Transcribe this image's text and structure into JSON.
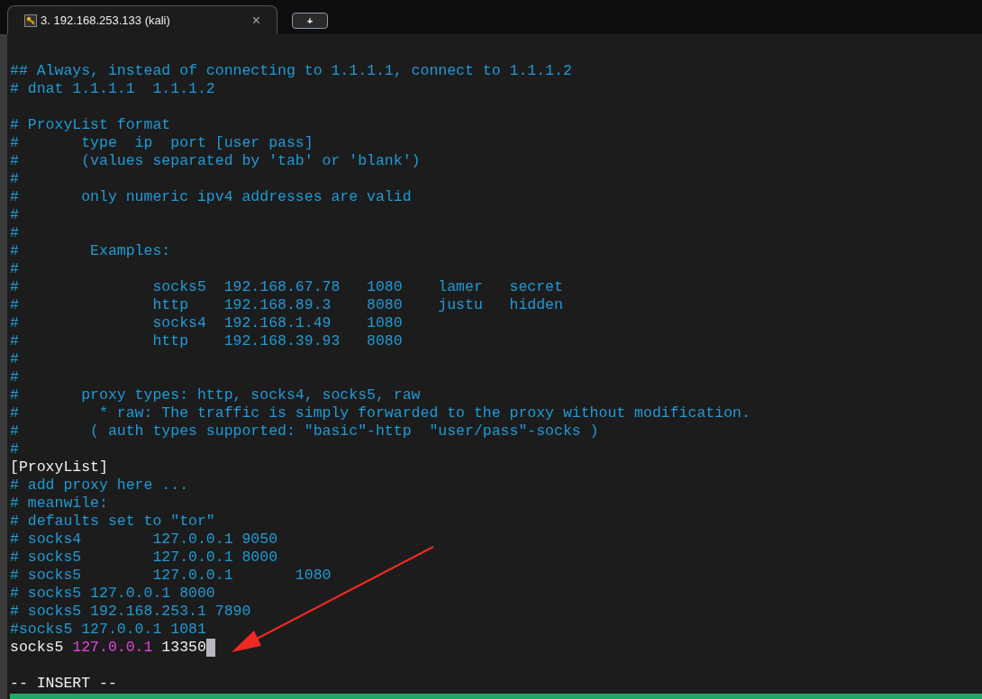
{
  "tab": {
    "title": "3. 192.168.253.133 (kali)",
    "close": "×",
    "new_tab": "+"
  },
  "lines": [
    {
      "kind": "text",
      "segments": [
        {
          "kind": "comment",
          "text": "## Always, instead of connecting to 1.1.1.1, connect to 1.1.1.2"
        }
      ]
    },
    {
      "kind": "text",
      "segments": [
        {
          "kind": "comment",
          "text": "# dnat 1.1.1.1  1.1.1.2"
        }
      ]
    },
    {
      "kind": "blank"
    },
    {
      "kind": "text",
      "segments": [
        {
          "kind": "comment",
          "text": "# ProxyList format"
        }
      ]
    },
    {
      "kind": "text",
      "segments": [
        {
          "kind": "comment",
          "text": "#       type  ip  port [user pass]"
        }
      ]
    },
    {
      "kind": "text",
      "segments": [
        {
          "kind": "comment",
          "text": "#       (values separated by 'tab' or 'blank')"
        }
      ]
    },
    {
      "kind": "text",
      "segments": [
        {
          "kind": "comment",
          "text": "#"
        }
      ]
    },
    {
      "kind": "text",
      "segments": [
        {
          "kind": "comment",
          "text": "#       only numeric ipv4 addresses are valid"
        }
      ]
    },
    {
      "kind": "text",
      "segments": [
        {
          "kind": "comment",
          "text": "#"
        }
      ]
    },
    {
      "kind": "text",
      "segments": [
        {
          "kind": "comment",
          "text": "#"
        }
      ]
    },
    {
      "kind": "text",
      "segments": [
        {
          "kind": "comment",
          "text": "#        Examples:"
        }
      ]
    },
    {
      "kind": "text",
      "segments": [
        {
          "kind": "comment",
          "text": "#"
        }
      ]
    },
    {
      "kind": "text",
      "segments": [
        {
          "kind": "comment",
          "text": "#               socks5  192.168.67.78   1080    lamer   secret"
        }
      ]
    },
    {
      "kind": "text",
      "segments": [
        {
          "kind": "comment",
          "text": "#               http    192.168.89.3    8080    justu   hidden"
        }
      ]
    },
    {
      "kind": "text",
      "segments": [
        {
          "kind": "comment",
          "text": "#               socks4  192.168.1.49    1080"
        }
      ]
    },
    {
      "kind": "text",
      "segments": [
        {
          "kind": "comment",
          "text": "#               http    192.168.39.93   8080"
        }
      ]
    },
    {
      "kind": "text",
      "segments": [
        {
          "kind": "comment",
          "text": "#"
        }
      ]
    },
    {
      "kind": "text",
      "segments": [
        {
          "kind": "comment",
          "text": "#"
        }
      ]
    },
    {
      "kind": "text",
      "segments": [
        {
          "kind": "comment",
          "text": "#       proxy types: http, socks4, socks5, raw"
        }
      ]
    },
    {
      "kind": "text",
      "segments": [
        {
          "kind": "comment",
          "text": "#         * raw: The traffic is simply forwarded to the proxy without modification."
        }
      ]
    },
    {
      "kind": "text",
      "segments": [
        {
          "kind": "comment",
          "text": "#        ( auth types supported: \"basic\"-http  \"user/pass\"-socks )"
        }
      ]
    },
    {
      "kind": "text",
      "segments": [
        {
          "kind": "comment",
          "text": "#"
        }
      ]
    },
    {
      "kind": "text",
      "segments": [
        {
          "kind": "plain",
          "text": "[ProxyList]"
        }
      ]
    },
    {
      "kind": "text",
      "segments": [
        {
          "kind": "comment",
          "text": "# add proxy here ..."
        }
      ]
    },
    {
      "kind": "text",
      "segments": [
        {
          "kind": "comment",
          "text": "# meanwile:"
        }
      ]
    },
    {
      "kind": "text",
      "segments": [
        {
          "kind": "comment",
          "text": "# defaults set to \"tor\""
        }
      ]
    },
    {
      "kind": "text",
      "segments": [
        {
          "kind": "comment",
          "text": "# socks4        127.0.0.1 9050"
        }
      ]
    },
    {
      "kind": "text",
      "segments": [
        {
          "kind": "comment",
          "text": "# socks5        127.0.0.1 8000"
        }
      ]
    },
    {
      "kind": "text",
      "segments": [
        {
          "kind": "comment",
          "text": "# socks5        127.0.0.1       1080"
        }
      ]
    },
    {
      "kind": "text",
      "segments": [
        {
          "kind": "comment",
          "text": "# socks5 127.0.0.1 8000"
        }
      ]
    },
    {
      "kind": "text",
      "segments": [
        {
          "kind": "comment",
          "text": "# socks5 192.168.253.1 7890"
        }
      ]
    },
    {
      "kind": "text",
      "segments": [
        {
          "kind": "comment",
          "text": "#socks5 127.0.0.1 1081"
        }
      ]
    },
    {
      "kind": "text",
      "segments": [
        {
          "kind": "plain",
          "text": "socks5 "
        },
        {
          "kind": "number",
          "text": "127.0.0.1"
        },
        {
          "kind": "plain",
          "text": " 13350"
        }
      ],
      "cursor": true
    },
    {
      "kind": "blank"
    },
    {
      "kind": "text",
      "segments": [
        {
          "kind": "plain",
          "text": "-- INSERT --"
        }
      ]
    }
  ]
}
